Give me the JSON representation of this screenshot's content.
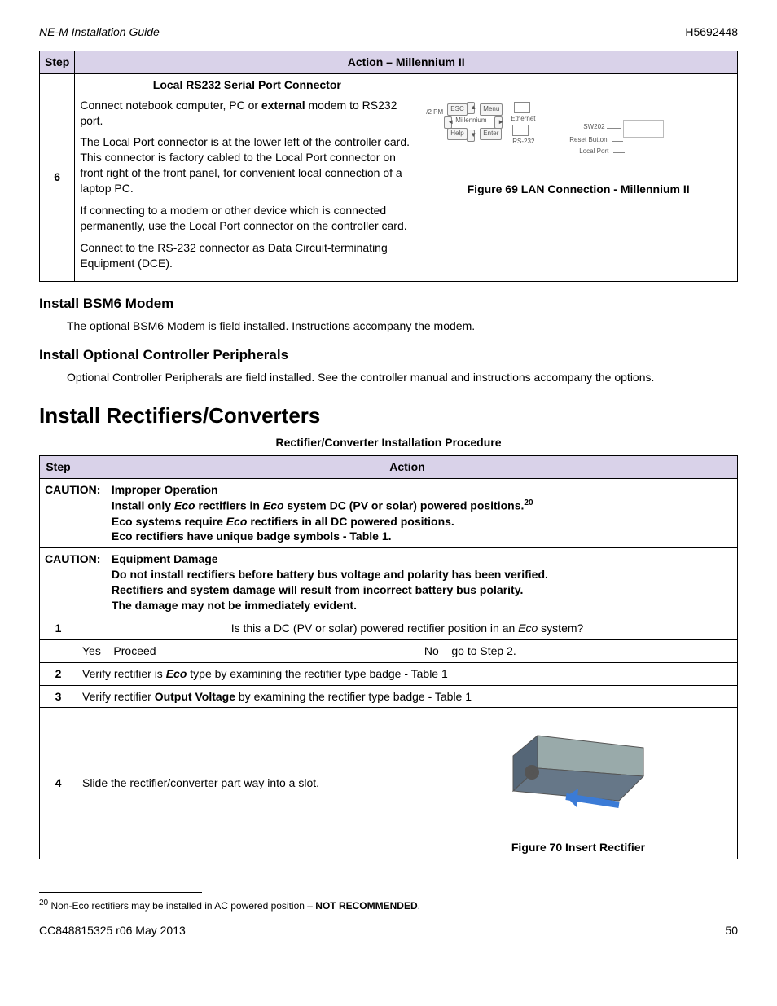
{
  "header": {
    "left": "NE-M Installation Guide",
    "right": "H5692448"
  },
  "table1": {
    "cols": {
      "step": "Step",
      "action": "Action – Millennium II"
    },
    "row": {
      "step": "6",
      "title": "Local RS232 Serial Port Connector",
      "p1_a": "Connect notebook computer, PC or ",
      "p1_b": "external",
      "p1_c": " modem to RS232 port.",
      "p2": "The Local Port connector is at the lower left of the controller card. This connector is factory cabled to the Local Port connector on front right of the front panel, for convenient local connection of a laptop PC.",
      "p3": "If connecting to a modem or other device which is connected permanently, use the Local Port connector on the controller card.",
      "p4": "Connect to the RS-232 connector as Data Circuit-terminating Equipment (DCE).",
      "fig_caption": "Figure 69 LAN Connection - Millennium II",
      "diag": {
        "esc": "ESC",
        "menu": "Menu",
        "help": "Help",
        "enter": "Enter",
        "millennium": "Millennium",
        "ethernet": "Ethernet",
        "rs232": "RS-232",
        "pm": "/2 PM",
        "sw202": "SW202",
        "reset": "Reset Button",
        "local": "Local Port"
      }
    }
  },
  "sections": {
    "bsm6_title": "Install BSM6 Modem",
    "bsm6_body": "The optional BSM6 Modem is field installed. Instructions accompany the modem.",
    "periph_title": "Install Optional Controller Peripherals",
    "periph_body": "Optional Controller Peripherals are field installed. See the controller manual and instructions accompany the options.",
    "rect_title": "Install Rectifiers/Converters",
    "rect_table_title": "Rectifier/Converter Installation Procedure"
  },
  "table2": {
    "cols": {
      "step": "Step",
      "action": "Action"
    },
    "caution1": {
      "label": "CAUTION:",
      "title": "Improper Operation",
      "l1a": "Install only ",
      "l1b": "Eco",
      "l1c": " rectifiers in ",
      "l1d": "Eco",
      "l1e": " system DC (PV or solar) powered positions.",
      "l1sup": "20",
      "l2a": "Eco systems require ",
      "l2b": "Eco",
      "l2c": " rectifiers in all DC powered positions.",
      "l3": "Eco rectifiers have unique badge symbols - Table 1."
    },
    "caution2": {
      "label": "CAUTION:",
      "title": "Equipment Damage",
      "l1": "Do not install rectifiers before battery bus voltage and polarity has been verified.",
      "l2": "Rectifiers and system damage will result from incorrect battery bus polarity.",
      "l3": "The damage may not be immediately evident."
    },
    "row1": {
      "step": "1",
      "text_a": "Is this a DC (PV or solar) powered rectifier position in an ",
      "text_b": "Eco",
      "text_c": " system?"
    },
    "row1b": {
      "left": "Yes – Proceed",
      "right": "No – go to Step 2."
    },
    "row2": {
      "step": "2",
      "a": "Verify rectifier is ",
      "b": "Eco",
      "c": " type by examining the rectifier type badge - Table 1"
    },
    "row3": {
      "step": "3",
      "a": "Verify rectifier ",
      "b": "Output Voltage",
      "c": " by examining the rectifier type badge - Table 1"
    },
    "row4": {
      "step": "4",
      "text": "Slide the rectifier/converter part way into a slot.",
      "fig_caption": "Figure 70 Insert Rectifier"
    }
  },
  "footnote": {
    "num": "20",
    "a": " Non-Eco rectifiers may be installed in AC powered position – ",
    "b": "NOT RECOMMENDED",
    "c": "."
  },
  "footer": {
    "left": "CC848815325  r06  May 2013",
    "right": "50"
  }
}
